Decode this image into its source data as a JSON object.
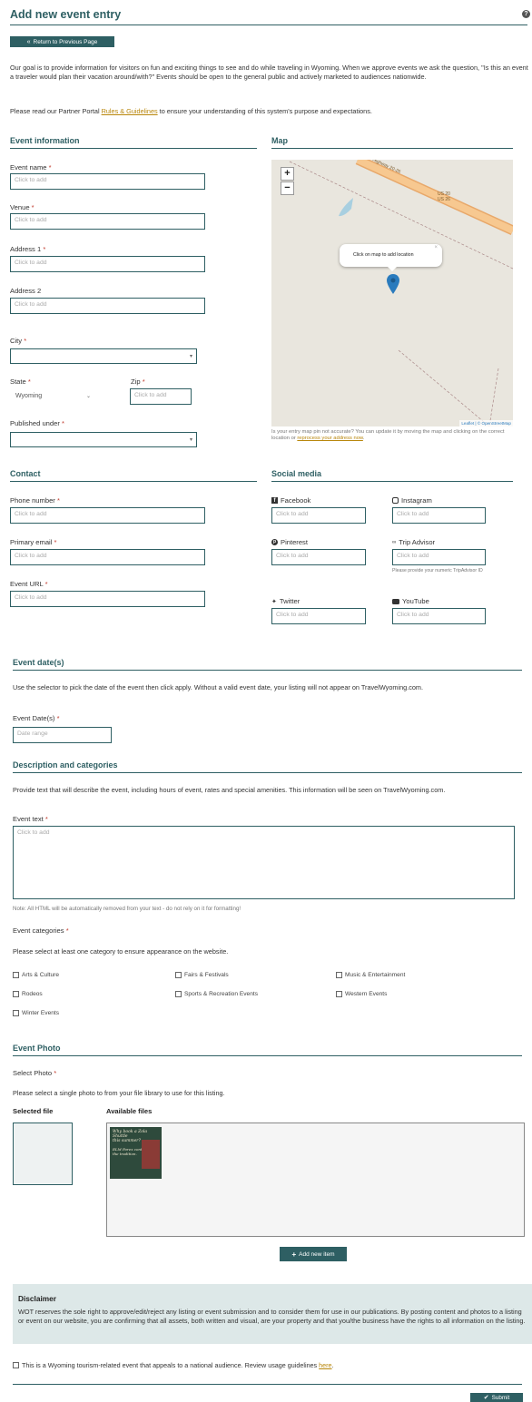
{
  "header": {
    "title": "Add new event entry",
    "back_button": "Return to Previous Page"
  },
  "intro": {
    "p1": "Our goal is to provide information for visitors on fun and exciting things to see and do while traveling in Wyoming. When we approve events we ask the question, \"Is this an event a traveler would plan their vacation around/with?\" Events should be open to the general public and actively marketed to audiences nationwide.",
    "p2_before": "Please read our Partner Portal ",
    "p2_link": "Rules & Guidelines",
    "p2_after": " to ensure your understanding of this system's purpose and expectations."
  },
  "event_info": {
    "title": "Event information",
    "event_name": {
      "label": "Event name",
      "placeholder": "Click to add"
    },
    "venue": {
      "label": "Venue",
      "placeholder": "Click to add"
    },
    "address1": {
      "label": "Address 1",
      "placeholder": "Click to add"
    },
    "address2": {
      "label": "Address 2",
      "placeholder": "Click to add"
    },
    "city": {
      "label": "City"
    },
    "state": {
      "label": "State",
      "value": "Wyoming"
    },
    "zip": {
      "label": "Zip",
      "placeholder": "Click to add"
    },
    "published_under": {
      "label": "Published under"
    }
  },
  "map": {
    "title": "Map",
    "popup": "Click on map to add location",
    "road_label1": "US 20",
    "road_label2": "US 26",
    "highway_label": "Highway 20-26",
    "attribution": "Leaflet | © OpenStreetMap",
    "note_before": "Is your entry map pin not accurate? You can update it by moving the map and clicking on the correct location or ",
    "note_link": "reprocess your address now",
    "note_after": "."
  },
  "contact": {
    "title": "Contact",
    "phone": {
      "label": "Phone number",
      "placeholder": "Click to add"
    },
    "email": {
      "label": "Primary email",
      "placeholder": "Click to add"
    },
    "url": {
      "label": "Event URL",
      "placeholder": "Click to add"
    }
  },
  "social": {
    "title": "Social media",
    "facebook": {
      "label": "Facebook",
      "placeholder": "Click to add"
    },
    "instagram": {
      "label": "Instagram",
      "placeholder": "Click to add"
    },
    "pinterest": {
      "label": "Pinterest",
      "placeholder": "Click to add"
    },
    "tripadvisor": {
      "label": "Trip Advisor",
      "placeholder": "Click to add",
      "help": "Please provide your numeric TripAdvisor ID"
    },
    "twitter": {
      "label": "Twitter",
      "placeholder": "Click to add"
    },
    "youtube": {
      "label": "YouTube",
      "placeholder": "Click to add"
    }
  },
  "dates": {
    "title": "Event date(s)",
    "desc": "Use the selector to pick the date of the event then click apply. Without a valid event date, your listing will not appear on TravelWyoming.com.",
    "label": "Event Date(s)",
    "placeholder": "Date range"
  },
  "description": {
    "title": "Description and categories",
    "desc": "Provide text that will describe the event, including hours of event, rates and special amenities. This information will be seen on TravelWyoming.com.",
    "text_label": "Event text",
    "text_placeholder": "Click to add",
    "note": "Note: All HTML will be automatically removed from your text - do not rely on it for formatting!",
    "cat_label": "Event categories",
    "cat_desc": "Please select at least one category to ensure appearance on the website.",
    "categories": [
      "Arts & Culture",
      "Fairs & Festivals",
      "Music & Entertainment",
      "Rodeos",
      "Sports & Recreation Events",
      "Western Events",
      "Winter Events"
    ]
  },
  "photo": {
    "title": "Event Photo",
    "select_label": "Select Photo",
    "desc": "Please select a single photo to from your file library to use for this listing.",
    "selected_label": "Selected file",
    "available_label": "Available files",
    "thumb_line1": "Why book a Zola Shuttle",
    "thumb_line2": "this summer?",
    "thumb_line3": "ELM Forex continues",
    "thumb_line4": "the tradition.",
    "add_button": "Add new item"
  },
  "disclaimer": {
    "title": "Disclaimer",
    "text": "WOT reserves the sole right to approve/edit/reject any listing or event submission and to consider them for use in our publications. By posting content and photos to a listing or event on our website, you are confirming that all assets, both written and visual, are your property and that you/the business have the rights to all information on the listing."
  },
  "consent": {
    "before": "This is a Wyoming tourism-related event that appeals to a national audience. Review usage guidelines ",
    "link": "here",
    "after": "."
  },
  "submit_label": "Submit",
  "required_mark": "*",
  "help_glyph": "?"
}
